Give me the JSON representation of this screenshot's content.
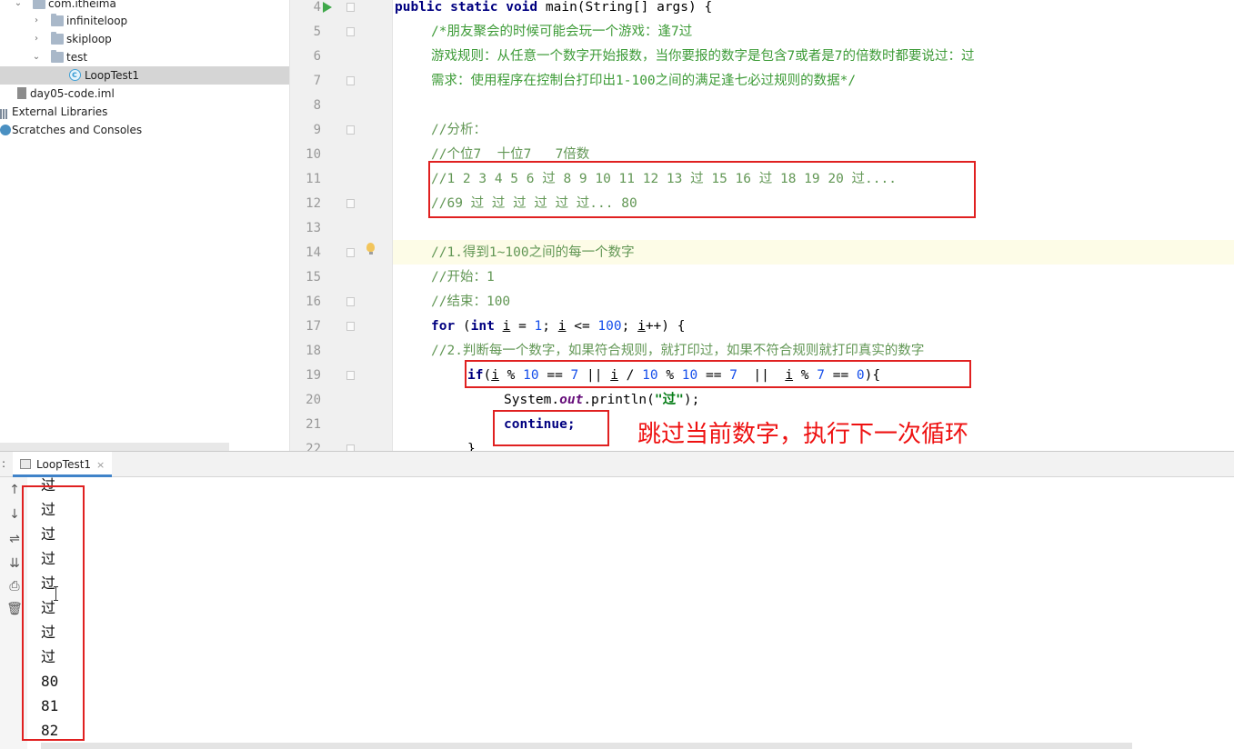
{
  "project_tree": {
    "items": [
      {
        "label": "com.itheima",
        "type": "package",
        "expanded": true
      },
      {
        "label": "infiniteloop",
        "type": "package",
        "expanded": false
      },
      {
        "label": "skiploop",
        "type": "package",
        "expanded": false
      },
      {
        "label": "test",
        "type": "package",
        "expanded": true
      },
      {
        "label": "LoopTest1",
        "type": "class",
        "selected": true
      },
      {
        "label": "day05-code.iml",
        "type": "file"
      },
      {
        "label": "External Libraries",
        "type": "libraries"
      },
      {
        "label": "Scratches and Consoles",
        "type": "scratches"
      }
    ]
  },
  "editor": {
    "line_numbers": [
      "4",
      "5",
      "6",
      "7",
      "8",
      "9",
      "10",
      "11",
      "12",
      "13",
      "14",
      "15",
      "16",
      "17",
      "18",
      "19",
      "20",
      "21",
      "22"
    ],
    "code": {
      "l4_kw": "public static void ",
      "l4_rest": "main(String[] args) {",
      "l5": "/*朋友聚会的时候可能会玩一个游戏：逢7过",
      "l6": "游戏规则：从任意一个数字开始报数，当你要报的数字是包含7或者是7的倍数时都要说过：过",
      "l7": "需求：使用程序在控制台打印出1-100之间的满足逢七必过规则的数据*/",
      "l9": "//分析：",
      "l10": "//个位7  十位7   7倍数",
      "l11": "//1 2 3 4 5 6 过 8 9 10 11 12 13 过 15 16 过 18 19 20 过....",
      "l12": "//69 过 过 过 过 过 过... 80",
      "l14": "//1.得到1~100之间的每一个数字",
      "l15": "//开始：1",
      "l16": "//结束：100",
      "l17_for": "for",
      "l17_p1": " (",
      "l17_int": "int",
      "l17_sp": " ",
      "l17_i1": "i",
      "l17_eq": " = ",
      "l17_one": "1",
      "l17_semi1": "; ",
      "l17_i2": "i",
      "l17_le": " <= ",
      "l17_hundred": "100",
      "l17_semi2": "; ",
      "l17_i3": "i",
      "l17_end": "++) {",
      "l18": "//2.判断每一个数字，如果符合规则，就打印过，如果不符合规则就打印真实的数字",
      "l19_if": "if",
      "l19_p": "(",
      "l19_i1": "i",
      "l19_a": " % ",
      "l19_n10a": "10",
      "l19_b": " == ",
      "l19_n7a": "7",
      "l19_c": " || ",
      "l19_i2": "i",
      "l19_d": " / ",
      "l19_n10b": "10",
      "l19_e": " % ",
      "l19_n10c": "10",
      "l19_f": " == ",
      "l19_n7b": "7",
      "l19_g": "  ||  ",
      "l19_i3": "i",
      "l19_h": " % ",
      "l19_n7c": "7",
      "l19_j": " == ",
      "l19_n0": "0",
      "l19_end": "){",
      "l20_a": "System.",
      "l20_out": "out",
      "l20_b": ".println(",
      "l20_str": "\"过\"",
      "l20_c": ");",
      "l21": "continue;",
      "l22": "}"
    },
    "annotation": "跳过当前数字，执行下一次循环"
  },
  "run_panel": {
    "tab_label": "LoopTest1",
    "tab_close": "×",
    "tab_prefix": ":",
    "tools": {
      "up": "↑",
      "down": "↓",
      "wrap": "⇌",
      "scroll_end": "⇊",
      "print": "⎙",
      "trash": "🗑"
    },
    "output": [
      "过",
      "过",
      "过",
      "过",
      "过",
      "过",
      "过",
      "过",
      "80",
      "81",
      "82"
    ]
  }
}
